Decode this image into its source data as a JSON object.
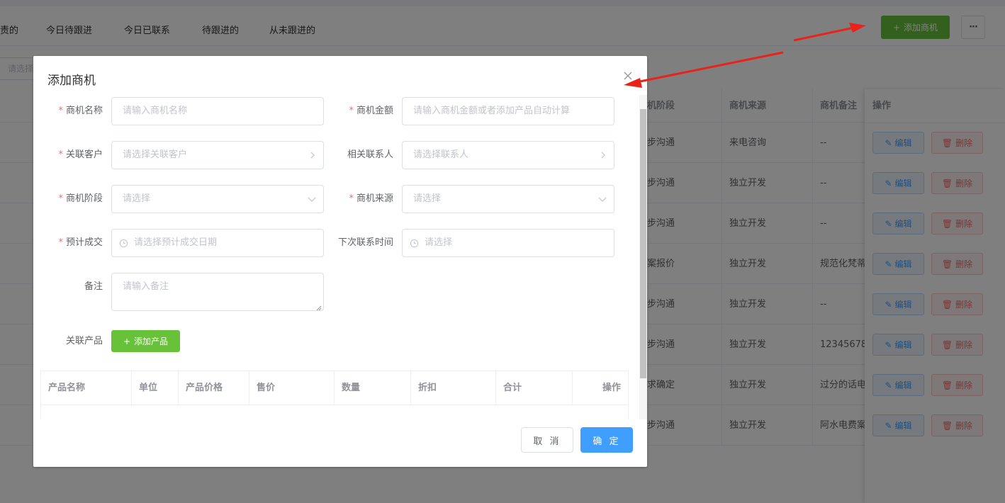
{
  "background": {
    "tabs": [
      "责的",
      "今日待跟进",
      "今日已联系",
      "待跟进的",
      "从未跟进的"
    ],
    "add_button_label": "添加商机",
    "more_label": "···",
    "filter_placeholder": "请选择",
    "table_headers": [
      "机阶段",
      "商机来源",
      "商机备注",
      "操作"
    ],
    "rows": [
      {
        "stage": "步沟通",
        "source": "来电咨询",
        "note": "--"
      },
      {
        "stage": "步沟通",
        "source": "独立开发",
        "note": "--"
      },
      {
        "stage": "步沟通",
        "source": "独立开发",
        "note": "--"
      },
      {
        "stage": "案报价",
        "source": "独立开发",
        "note": "规范化梵蒂"
      },
      {
        "stage": "步沟通",
        "source": "独立开发",
        "note": "--"
      },
      {
        "stage": "步沟通",
        "source": "独立开发",
        "note": "12345678"
      },
      {
        "stage": "求确定",
        "source": "独立开发",
        "note": "过分的话电"
      },
      {
        "stage": "步沟通",
        "source": "独立开发",
        "note": "阿水电费案"
      }
    ],
    "edit_label": "编辑",
    "delete_label": "删除"
  },
  "dialog": {
    "title": "添加商机",
    "fields": {
      "name": {
        "label": "商机名称",
        "placeholder": "请输入商机名称",
        "required": true
      },
      "amount": {
        "label": "商机金额",
        "placeholder": "请输入商机金额或者添加产品自动计算",
        "required": true
      },
      "customer": {
        "label": "关联客户",
        "placeholder": "请选择关联客户",
        "required": true
      },
      "contact": {
        "label": "相关联系人",
        "placeholder": "请选择联系人",
        "required": false
      },
      "stage": {
        "label": "商机阶段",
        "placeholder": "请选择",
        "required": true
      },
      "source": {
        "label": "商机来源",
        "placeholder": "请选择",
        "required": true
      },
      "deal_date": {
        "label": "预计成交",
        "placeholder": "请选择预计成交日期",
        "required": true
      },
      "next_contact": {
        "label": "下次联系时间",
        "placeholder": "请选择",
        "required": false
      },
      "remark": {
        "label": "备注",
        "placeholder": "请输入备注",
        "required": false
      }
    },
    "products_label": "关联产品",
    "add_product_label": "添加产品",
    "product_table_headers": [
      "产品名称",
      "单位",
      "产品价格",
      "售价",
      "数量",
      "折扣",
      "合计",
      "操作"
    ],
    "cancel_label": "取 消",
    "confirm_label": "确 定"
  },
  "colors": {
    "primary": "#409eff",
    "success": "#67c23a",
    "danger": "#f56c6c",
    "annotation_arrow": "#e8231a"
  }
}
